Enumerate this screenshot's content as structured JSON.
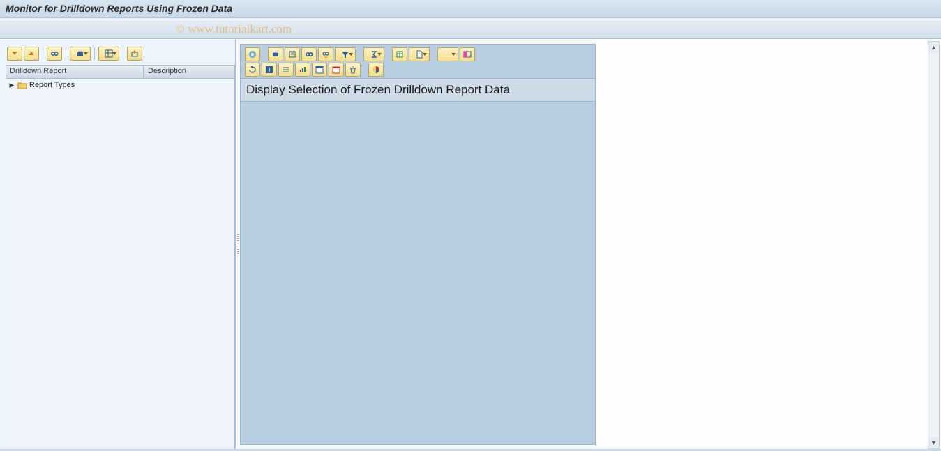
{
  "title": "Monitor for Drilldown Reports Using Frozen Data",
  "watermark": "© www.tutorialkart.com",
  "left_panel": {
    "toolbar_icons": [
      "expand-all",
      "collapse-all",
      "find",
      "print",
      "layout",
      "export"
    ],
    "columns": {
      "report": "Drilldown Report",
      "description": "Description"
    },
    "tree": {
      "root_label": "Report Types"
    }
  },
  "right_panel": {
    "heading": "Display Selection of Frozen Drilldown Report Data",
    "toolbar_row1": [
      "details",
      "print",
      "print-preview",
      "find",
      "find-next",
      "filter",
      "sum",
      "subtotal",
      "export-xls",
      "local-file",
      "mail",
      "select-layout"
    ],
    "toolbar_row2": [
      "refresh",
      "info",
      "list",
      "abc",
      "graphic",
      "calendar",
      "delete",
      "chart-color"
    ]
  }
}
